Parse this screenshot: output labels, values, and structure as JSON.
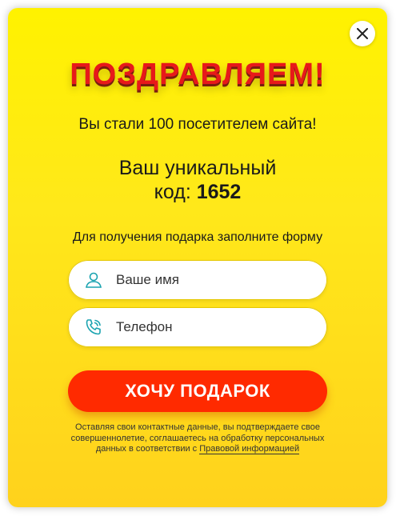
{
  "popup": {
    "title": "ПОЗДРАВЛЯЕМ!",
    "subtitle": "Вы стали 100 посетителем сайта!",
    "code_line1": "Ваш уникальный",
    "code_prefix": "код:",
    "code_value": "1652",
    "hint": "Для получения подарка заполните форму",
    "name_placeholder": "Ваше имя",
    "phone_placeholder": "Телефон",
    "submit_label": "ХОЧУ ПОДАРОК",
    "legal_text": "Оставляя свои контактные данные, вы подтверждаете свое совершеннолетие, соглашаетесь на обработку персональных данных в соответствии с",
    "legal_link": "Правовой информацией"
  },
  "icons": {
    "close": "close-icon",
    "name": "user-icon",
    "phone": "phone-icon"
  },
  "colors": {
    "background_top": "#fff200",
    "background_bottom": "#ffd21c",
    "title": "#e7191a",
    "button": "#ff2a00",
    "icon": "#1aa3b0"
  }
}
